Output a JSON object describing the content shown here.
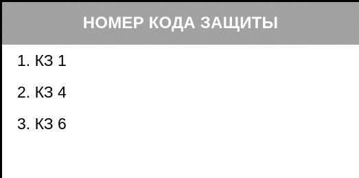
{
  "header": {
    "title": "НОМЕР КОДА ЗАЩИТЫ"
  },
  "list": {
    "items": [
      {
        "label": "1. КЗ 1"
      },
      {
        "label": "2. КЗ 4"
      },
      {
        "label": "3. КЗ 6"
      }
    ]
  },
  "colors": {
    "header_bg": "#9e9e9e",
    "header_text": "#ffffff",
    "border": "#000000",
    "text": "#000000"
  }
}
